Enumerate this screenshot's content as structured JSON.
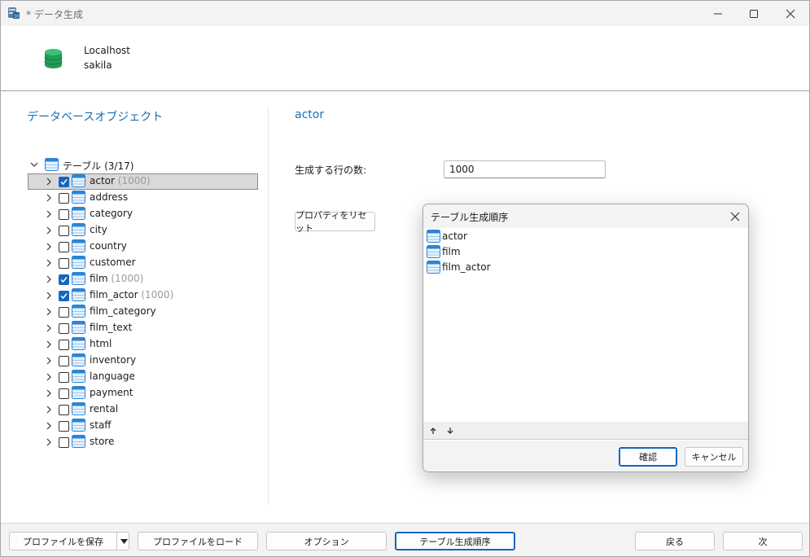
{
  "window": {
    "title": "* データ生成",
    "minimize_icon": "minimize-icon",
    "maximize_icon": "maximize-icon",
    "close_icon": "close-icon"
  },
  "connection": {
    "name": "Localhost",
    "database": "sakila",
    "icon": "database-icon",
    "icon_color": "#1f9d55"
  },
  "left_pane": {
    "title": "データベースオブジェクト",
    "root": {
      "label": "テーブル (3/17)",
      "expanded": true
    },
    "tables": [
      {
        "name": "actor",
        "checked": true,
        "count": "(1000)",
        "selected": true
      },
      {
        "name": "address",
        "checked": false,
        "count": ""
      },
      {
        "name": "category",
        "checked": false,
        "count": ""
      },
      {
        "name": "city",
        "checked": false,
        "count": ""
      },
      {
        "name": "country",
        "checked": false,
        "count": ""
      },
      {
        "name": "customer",
        "checked": false,
        "count": ""
      },
      {
        "name": "film",
        "checked": true,
        "count": "(1000)"
      },
      {
        "name": "film_actor",
        "checked": true,
        "count": "(1000)"
      },
      {
        "name": "film_category",
        "checked": false,
        "count": ""
      },
      {
        "name": "film_text",
        "checked": false,
        "count": ""
      },
      {
        "name": "html",
        "checked": false,
        "count": ""
      },
      {
        "name": "inventory",
        "checked": false,
        "count": ""
      },
      {
        "name": "language",
        "checked": false,
        "count": ""
      },
      {
        "name": "payment",
        "checked": false,
        "count": ""
      },
      {
        "name": "rental",
        "checked": false,
        "count": ""
      },
      {
        "name": "staff",
        "checked": false,
        "count": ""
      },
      {
        "name": "store",
        "checked": false,
        "count": ""
      }
    ]
  },
  "right_pane": {
    "title": "actor",
    "rows_label": "生成する行の数:",
    "rows_value": "1000",
    "reset_button": "プロパティをリセット"
  },
  "dialog": {
    "title": "テーブル生成順序",
    "items": [
      "actor",
      "film",
      "film_actor"
    ],
    "up_icon": "arrow-up-icon",
    "down_icon": "arrow-down-icon",
    "ok_button": "確認",
    "cancel_button": "キャンセル"
  },
  "bottom_bar": {
    "save_profile": "プロファイルを保存",
    "load_profile": "プロファイルをロード",
    "options": "オプション",
    "table_order": "テーブル生成順序",
    "back": "戻る",
    "next": "次"
  },
  "colors": {
    "accent": "#1565c0",
    "section_title": "#1a6fb3",
    "table_icon": "#2b84d6"
  }
}
